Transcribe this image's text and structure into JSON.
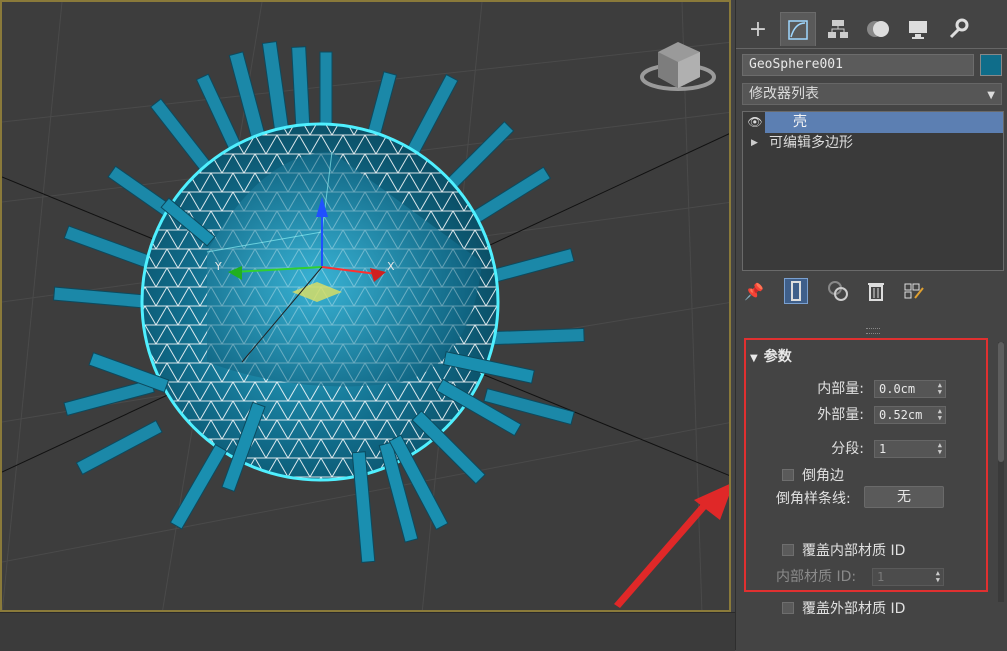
{
  "tabs": [
    {
      "name": "create-tab",
      "icon": "plus-icon",
      "glyph": "+"
    },
    {
      "name": "modify-tab",
      "icon": "modify-icon",
      "glyph": "⌒"
    },
    {
      "name": "hierarchy-tab",
      "icon": "hierarchy-icon",
      "glyph": "⊞"
    },
    {
      "name": "motion-tab",
      "icon": "motion-icon",
      "glyph": "◐"
    },
    {
      "name": "display-tab",
      "icon": "display-icon",
      "glyph": "▭"
    },
    {
      "name": "utilities-tab",
      "icon": "wrench-icon",
      "glyph": "🔧"
    }
  ],
  "object": {
    "name": "GeoSphere001",
    "color": "#0f6d8a"
  },
  "modifier_list": {
    "label": "修改器列表"
  },
  "stack": {
    "items": [
      {
        "label": "壳",
        "selected": true
      },
      {
        "label": "可编辑多边形",
        "selected": false
      }
    ]
  },
  "params": {
    "title": "参数",
    "inner_amount_label": "内部量:",
    "inner_amount": "0.0cm",
    "outer_amount_label": "外部量:",
    "outer_amount": "0.52cm",
    "segments_label": "分段:",
    "segments": "1",
    "bevel_edges_label": "倒角边",
    "bevel_spline_label": "倒角样条线:",
    "bevel_spline_button": "无",
    "override_inner_mat_label": "覆盖内部材质 ID",
    "inner_mat_id_label": "内部材质 ID:",
    "inner_mat_id": "1",
    "override_outer_mat_label": "覆盖外部材质 ID"
  },
  "viewport": {
    "gizmo_x": "X",
    "gizmo_y": "Y",
    "accent": "#1aa0c0",
    "selection": "#40e6ff"
  },
  "annotation": {
    "color": "#e02828"
  }
}
